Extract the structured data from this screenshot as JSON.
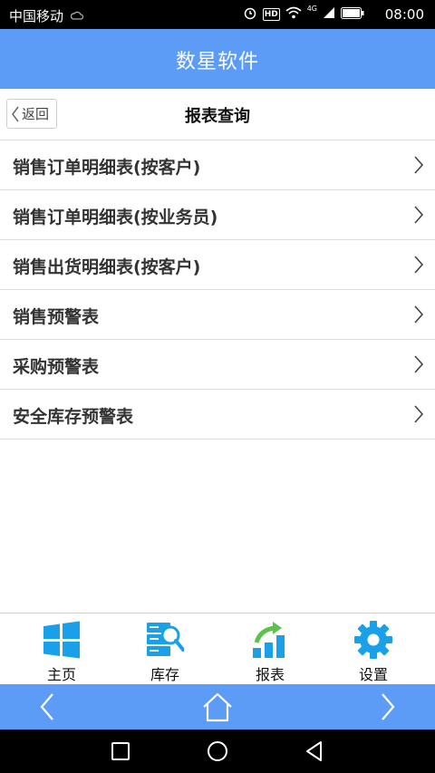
{
  "status_bar": {
    "carrier": "中国移动",
    "time": "08:00",
    "hd_label": "HD",
    "network_label": "4G",
    "icons": [
      "cloud-icon",
      "alarm-icon",
      "hd-icon",
      "wifi-icon",
      "signal-icon",
      "battery-icon"
    ]
  },
  "app_bar": {
    "title": "数星软件",
    "color": "#5d9cf6"
  },
  "sub_header": {
    "back_label": "返回",
    "page_title": "报表查询"
  },
  "menu": {
    "items": [
      {
        "label": "销售订单明细表(按客户)"
      },
      {
        "label": "销售订单明细表(按业务员)"
      },
      {
        "label": "销售出货明细表(按客户)"
      },
      {
        "label": "销售预警表"
      },
      {
        "label": "采购预警表"
      },
      {
        "label": "安全库存预警表"
      }
    ]
  },
  "tab_bar": {
    "tabs": [
      {
        "label": "主页",
        "icon": "windows-icon"
      },
      {
        "label": "库存",
        "icon": "inventory-search-icon"
      },
      {
        "label": "报表",
        "icon": "report-chart-icon"
      },
      {
        "label": "设置",
        "icon": "gear-icon"
      }
    ],
    "icon_color": "#1aa0e8"
  },
  "nav_bar": {
    "icons": [
      "chevron-left-icon",
      "home-icon",
      "chevron-right-icon"
    ]
  },
  "system_nav": {
    "icons": [
      "recents-square-icon",
      "home-circle-icon",
      "back-triangle-icon"
    ]
  }
}
